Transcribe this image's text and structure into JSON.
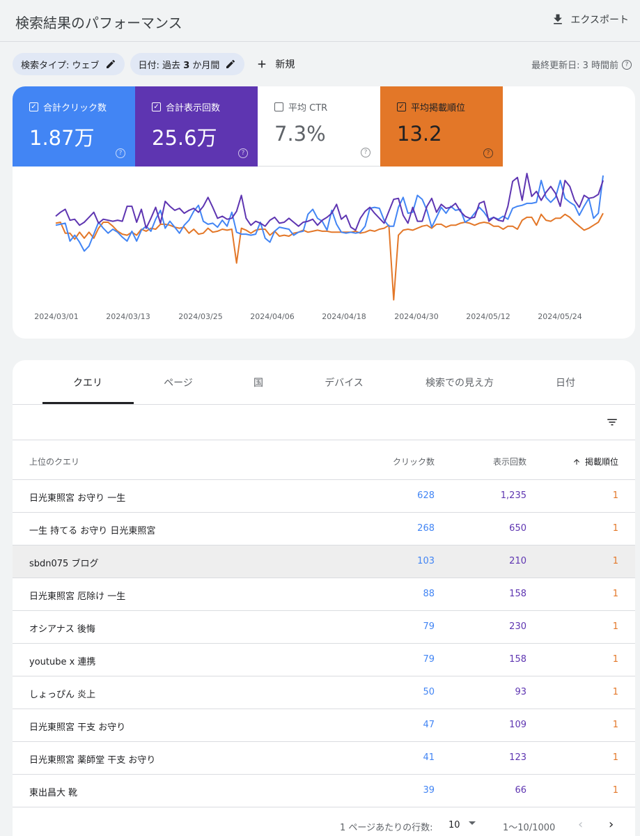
{
  "header": {
    "title": "検索結果のパフォーマンス",
    "export_label": "エクスポート"
  },
  "filters": {
    "search_type_prefix": "検索タイプ: ",
    "search_type_value": "ウェブ",
    "date_prefix": "日付: 過去 ",
    "date_bold": "3",
    "date_suffix": " か月間",
    "new_label": "新規",
    "last_updated": "最終更新日: 3 時間前"
  },
  "metrics": [
    {
      "label": "合計クリック数",
      "value": "1.87万",
      "checked": true,
      "color": "#4285f4"
    },
    {
      "label": "合計表示回数",
      "value": "25.6万",
      "checked": true,
      "color": "#5e35b1"
    },
    {
      "label": "平均 CTR",
      "value": "7.3%",
      "checked": false,
      "color": "#ffffff"
    },
    {
      "label": "平均掲載順位",
      "value": "13.2",
      "checked": true,
      "color": "#e37728"
    }
  ],
  "chart_data": {
    "type": "line",
    "x_tick_labels": [
      "2024/03/01",
      "2024/03/13",
      "2024/03/25",
      "2024/04/06",
      "2024/04/18",
      "2024/04/30",
      "2024/05/12",
      "2024/05/24"
    ],
    "y_axis_visible": false,
    "grid": false,
    "note": "Relative trend values (0-100 scale, higher = higher on chart); y-axis not labeled in the original.",
    "series": [
      {
        "color": "#5e35b1",
        "values": [
          50,
          54,
          57,
          46,
          47,
          41,
          44,
          49,
          54,
          43,
          47,
          46,
          45,
          46,
          45,
          60,
          60,
          44,
          57,
          38,
          48,
          59,
          43,
          65,
          60,
          56,
          58,
          53,
          56,
          58,
          54,
          60,
          69,
          59,
          48,
          50,
          47,
          48,
          55,
          71,
          48,
          41,
          45,
          43,
          40,
          46,
          49,
          43,
          44,
          48,
          44,
          40,
          44,
          45,
          47,
          41,
          46,
          49,
          53,
          62,
          47,
          51,
          39,
          36,
          48,
          55,
          59,
          53,
          48,
          43,
          55,
          67,
          68,
          51,
          43,
          59,
          45,
          45,
          60,
          68,
          54,
          62,
          58,
          59,
          63,
          55,
          50,
          48,
          49,
          63,
          65,
          45,
          49,
          46,
          45,
          60,
          85,
          89,
          66,
          93,
          70,
          75,
          66,
          74,
          80,
          73,
          60,
          86,
          80,
          66,
          59,
          71,
          68,
          69,
          72,
          86
        ]
      },
      {
        "color": "#4285f4",
        "values": [
          41,
          42,
          43,
          25,
          31,
          24,
          15,
          20,
          32,
          44,
          38,
          33,
          37,
          34,
          29,
          25,
          35,
          25,
          36,
          40,
          35,
          47,
          56,
          38,
          45,
          39,
          33,
          41,
          46,
          55,
          61,
          45,
          42,
          43,
          39,
          46,
          40,
          54,
          34,
          32,
          32,
          31,
          32,
          44,
          28,
          24,
          35,
          39,
          38,
          37,
          31,
          34,
          35,
          52,
          57,
          48,
          45,
          36,
          56,
          42,
          34,
          33,
          34,
          33,
          34,
          40,
          58,
          59,
          58,
          46,
          40,
          40,
          59,
          69,
          53,
          54,
          71,
          67,
          56,
          39,
          49,
          59,
          53,
          60,
          56,
          57,
          44,
          47,
          53,
          59,
          54,
          47,
          49,
          47,
          50,
          47,
          58,
          60,
          61,
          63,
          63,
          64,
          86,
          69,
          64,
          69,
          86,
          68,
          64,
          61,
          51,
          60,
          68,
          48,
          53,
          91
        ]
      },
      {
        "color": "#e37728",
        "values": [
          43,
          44,
          33,
          33,
          27,
          34,
          28,
          34,
          28,
          38,
          44,
          44,
          40,
          35,
          32,
          31,
          34,
          31,
          37,
          35,
          38,
          37,
          42,
          42,
          41,
          39,
          38,
          39,
          33,
          37,
          32,
          33,
          38,
          34,
          35,
          37,
          36,
          37,
          3,
          38,
          36,
          33,
          36,
          37,
          37,
          31,
          35,
          30,
          31,
          30,
          33,
          34,
          36,
          34,
          35,
          36,
          35,
          35,
          34,
          34,
          34,
          34,
          34,
          35,
          33,
          34,
          36,
          35,
          37,
          38,
          41,
          -34,
          31,
          36,
          37,
          36,
          38,
          40,
          41,
          38,
          42,
          42,
          39,
          41,
          41,
          43,
          44,
          43,
          41,
          43,
          44,
          43,
          40,
          40,
          37,
          40,
          40,
          37,
          46,
          49,
          49,
          41,
          52,
          46,
          45,
          48,
          48,
          52,
          49,
          44,
          40,
          36,
          38,
          41,
          44,
          53
        ]
      }
    ]
  },
  "tabs": [
    "クエリ",
    "ページ",
    "国",
    "デバイス",
    "検索での見え方",
    "日付"
  ],
  "table": {
    "headers": {
      "query": "上位のクエリ",
      "clicks": "クリック数",
      "impressions": "表示回数",
      "position": "掲載順位"
    },
    "rows": [
      {
        "query": "日光東照宮 お守り 一生",
        "clicks": "628",
        "impressions": "1,235",
        "position": "1"
      },
      {
        "query": "一生 持てる お守り 日光東照宮",
        "clicks": "268",
        "impressions": "650",
        "position": "1"
      },
      {
        "query": "sbdn075 ブログ",
        "clicks": "103",
        "impressions": "210",
        "position": "1"
      },
      {
        "query": "日光東照宮 厄除け 一生",
        "clicks": "88",
        "impressions": "158",
        "position": "1"
      },
      {
        "query": "オシアナス 後悔",
        "clicks": "79",
        "impressions": "230",
        "position": "1"
      },
      {
        "query": "youtube x 連携",
        "clicks": "79",
        "impressions": "158",
        "position": "1"
      },
      {
        "query": "しょっぴん 炎上",
        "clicks": "50",
        "impressions": "93",
        "position": "1"
      },
      {
        "query": "日光東照宮 干支 お守り",
        "clicks": "47",
        "impressions": "109",
        "position": "1"
      },
      {
        "query": "日光東照宮 薬師堂 干支 お守り",
        "clicks": "41",
        "impressions": "123",
        "position": "1"
      },
      {
        "query": "東出昌大 靴",
        "clicks": "39",
        "impressions": "66",
        "position": "1"
      }
    ]
  },
  "pagination": {
    "rows_per_page_label": "1 ページあたりの行数:",
    "rows_per_page_value": "10",
    "range": "1～10/1000"
  },
  "icons": [
    "download-icon",
    "pencil-icon",
    "plus-icon",
    "help-icon",
    "checkbox-icon",
    "filter-icon",
    "arrow-up-icon",
    "chevron-left-icon",
    "chevron-right-icon",
    "dropdown-arrow-icon"
  ]
}
